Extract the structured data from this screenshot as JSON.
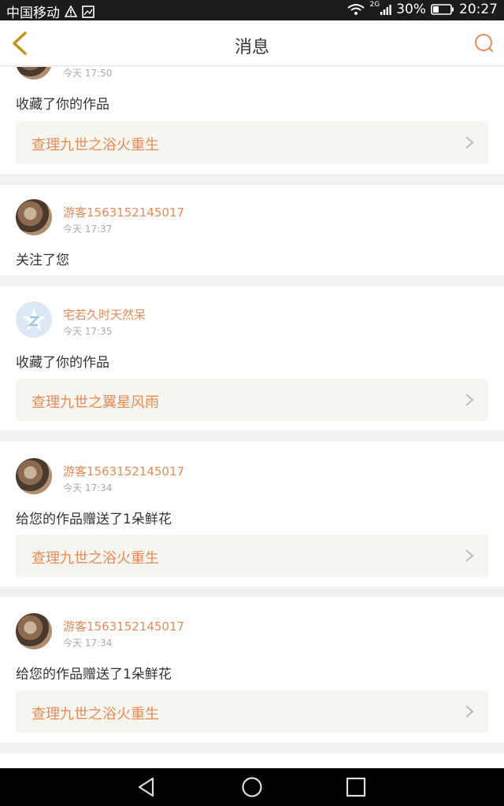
{
  "status_bar": {
    "carrier": "中国移动",
    "network": "2G",
    "battery": "30%",
    "time": "20:27"
  },
  "header": {
    "title": "消息"
  },
  "colors": {
    "accent": "#e88b57",
    "back_arrow": "#e0b23a",
    "card_link_bg": "#f6f5ef"
  },
  "messages": [
    {
      "username": "",
      "time": "今天 17:50",
      "action": "收藏了你的作品",
      "work_title": "查理九世之浴火重生",
      "avatar": "photo-avatar-partial"
    },
    {
      "username": "游客1563152145017",
      "time": "今天 17:37",
      "action": "关注了您",
      "work_title": "",
      "avatar": "photo-avatar"
    },
    {
      "username": "宅若久时天然呆",
      "time": "今天 17:35",
      "action": "收藏了你的作品",
      "work_title": "查理九世之翼星风雨",
      "avatar": "default-avatar"
    },
    {
      "username": "游客1563152145017",
      "time": "今天 17:34",
      "action": "给您的作品赠送了1朵鲜花",
      "work_title": "查理九世之浴火重生",
      "avatar": "photo-avatar"
    },
    {
      "username": "游客1563152145017",
      "time": "今天 17:34",
      "action": "给您的作品赠送了1朵鲜花",
      "work_title": "查理九世之浴火重生",
      "avatar": "photo-avatar"
    }
  ],
  "nav_bar": {
    "icons": [
      "back-triangle-icon",
      "home-circle-icon",
      "recents-square-icon"
    ]
  }
}
